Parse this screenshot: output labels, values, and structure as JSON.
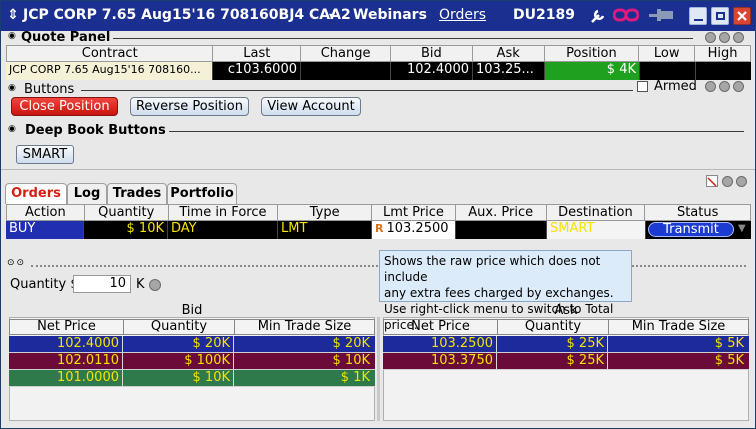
{
  "titlebar": {
    "symbol": "JCP CORP 7.65 Aug15'16 708160BJ4 CAA2",
    "webinars": "Webinars",
    "orders": "Orders",
    "account": "DU2189"
  },
  "quote_panel": {
    "title": "Quote Panel",
    "headers": [
      "Contract",
      "Last",
      "Change",
      "Bid",
      "Ask",
      "Position",
      "Low",
      "High"
    ],
    "row": {
      "contract": "JCP CORP 7.65 Aug15'16 708160...",
      "last": "c103.6000",
      "change": "",
      "bid": "102.4000",
      "ask": "103.25...",
      "position": "$ 4K",
      "low": "",
      "high": ""
    }
  },
  "buttons_panel": {
    "title": "Buttons",
    "armed_label": "Armed",
    "close_position": "Close Position",
    "reverse_position": "Reverse Position",
    "view_account": "View Account"
  },
  "deep_book": {
    "title": "Deep Book Buttons",
    "smart": "SMART"
  },
  "tabs": [
    "Orders",
    "Log",
    "Trades",
    "Portfolio"
  ],
  "orders_grid": {
    "headers": [
      "Action",
      "Quantity",
      "Time in Force",
      "Type",
      "Lmt Price",
      "Aux. Price",
      "Destination",
      "Status"
    ],
    "row": {
      "action": "BUY",
      "quantity": "$ 10K",
      "tif": "DAY",
      "type": "LMT",
      "lmt_badge": "R",
      "lmt_price": "103.2500",
      "aux_price": "",
      "destination": "SMART",
      "status": "Transmit"
    }
  },
  "tooltip": {
    "line1": "Shows the raw price which does not include",
    "line2": "any extra fees charged by exchanges.",
    "line3": "Use right-click menu to switch to Total price."
  },
  "depth": {
    "quantity_label": "Quantity",
    "quantity_unit": "$",
    "quantity_value": "10",
    "quantity_suffix": "K",
    "bid_title": "Bid",
    "ask_title": "Ask",
    "headers": [
      "Net Price",
      "Quantity",
      "Min Trade Size"
    ],
    "bid_rows": [
      {
        "price": "102.4000",
        "qty": "$ 20K",
        "min": "$ 20K"
      },
      {
        "price": "102.0110",
        "qty": "$ 100K",
        "min": "$ 10K"
      },
      {
        "price": "101.0000",
        "qty": "$ 10K",
        "min": "$ 1K"
      }
    ],
    "ask_rows": [
      {
        "price": "103.2500",
        "qty": "$ 25K",
        "min": "$ 5K"
      },
      {
        "price": "103.3750",
        "qty": "$ 25K",
        "min": "$ 5K"
      }
    ]
  },
  "colors": {
    "title_bg": "#1a2f8f",
    "buy_bg": "#1f2fb0",
    "yellow_text": "#f5e300",
    "position_green": "#1fa01f",
    "row_blue": "#1c2a9a",
    "row_maroon": "#6a0b3a",
    "row_green": "#2e7a4a",
    "tab_red": "#d61f13"
  }
}
